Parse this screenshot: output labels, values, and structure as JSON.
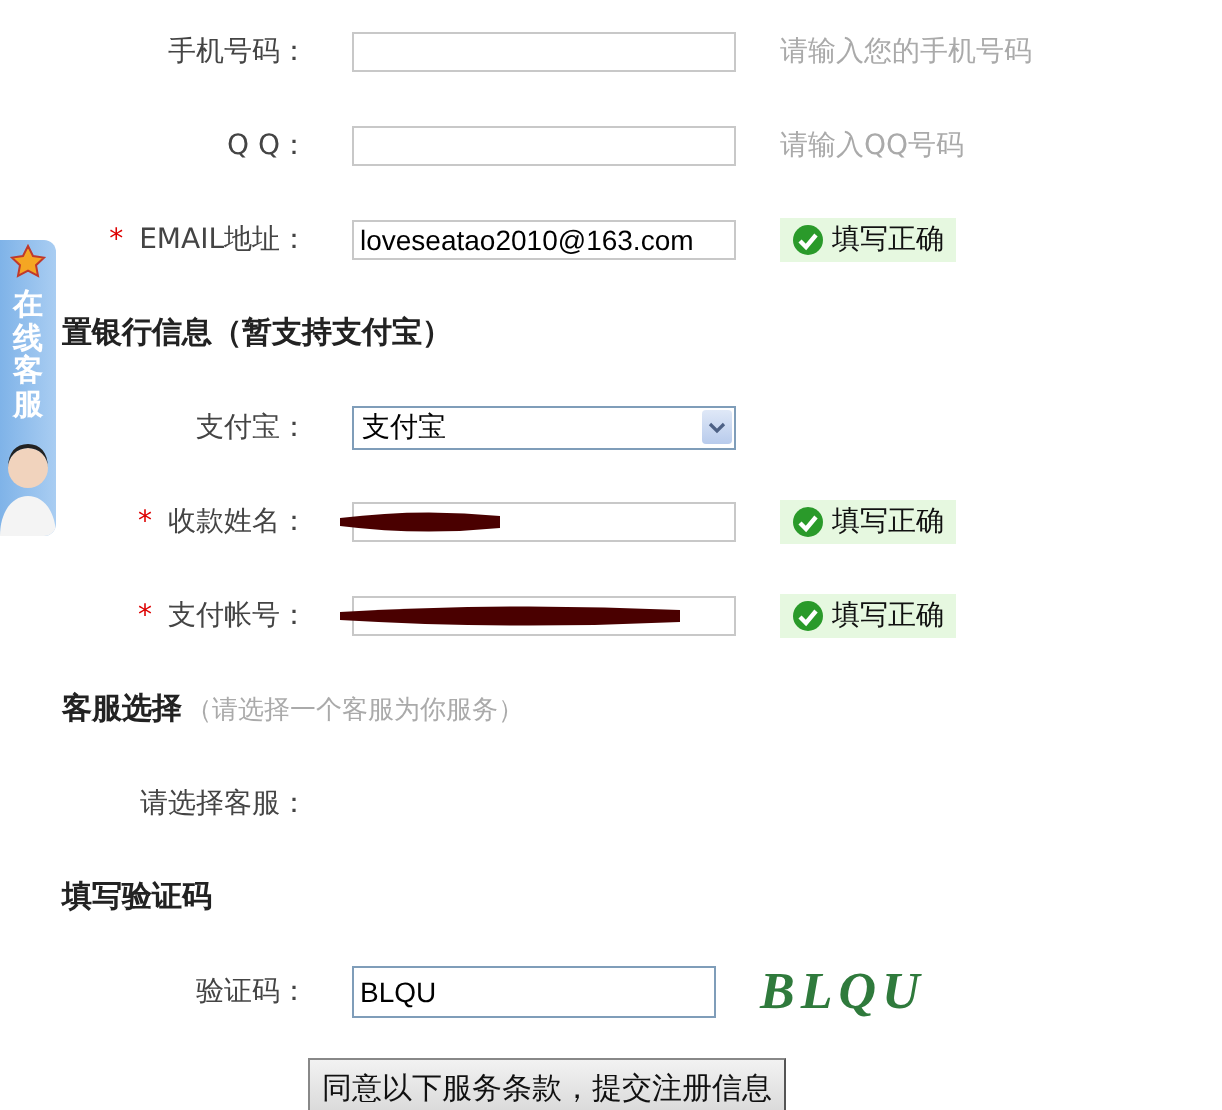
{
  "items": [
    {
      "kind": "field",
      "label": "手机号码：",
      "hint": "请输入您的手机号码"
    },
    {
      "kind": "field",
      "label": "Q Q：",
      "hint": "请输入QQ号码"
    },
    {
      "kind": "field",
      "label": "EMAIL地址：",
      "required_mark": "*",
      "value": "loveseatao2010@163.com",
      "status": "填写正确"
    },
    {
      "kind": "heading",
      "title": "置银行信息（暂支持支付宝）"
    },
    {
      "kind": "select",
      "label": "支付宝：",
      "value": "支付宝"
    },
    {
      "kind": "field",
      "label": "收款姓名：",
      "required_mark": "*",
      "redacted": true,
      "status": "填写正确"
    },
    {
      "kind": "field",
      "label": "支付帐号：",
      "required_mark": "*",
      "redacted": true,
      "status": "填写正确"
    },
    {
      "kind": "heading",
      "title": "客服选择",
      "note": "（请选择一个客服为你服务）"
    },
    {
      "kind": "label",
      "label": "请选择客服："
    },
    {
      "kind": "heading",
      "title": "填写验证码"
    },
    {
      "kind": "captcha",
      "label": "验证码：",
      "value": "BLQU",
      "code": "BLQU"
    },
    {
      "kind": "button",
      "label": "同意以下服务条款，提交注册信息"
    }
  ],
  "service_widget": {
    "label": "在线客服"
  }
}
